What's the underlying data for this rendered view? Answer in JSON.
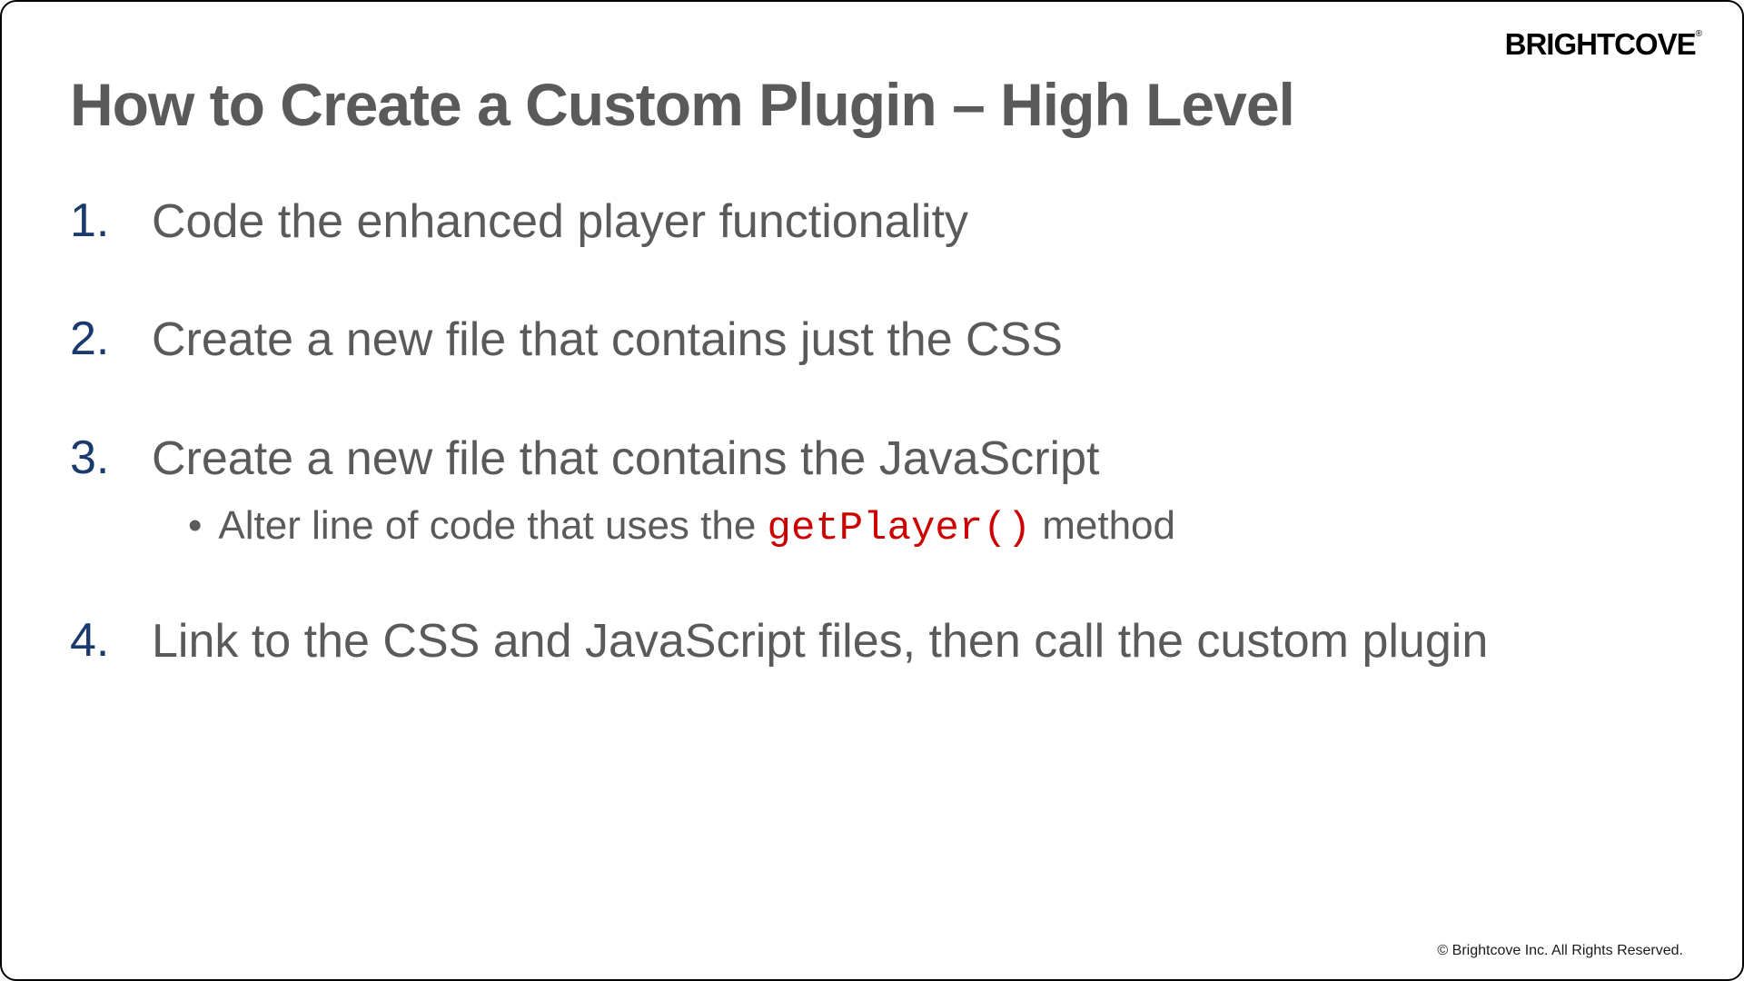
{
  "logo": {
    "text": "BRIGHTCOVE",
    "reg": "®"
  },
  "title": "How to Create a Custom Plugin – High Level",
  "items": [
    {
      "number": "1.",
      "text": "Code the enhanced player functionality"
    },
    {
      "number": "2.",
      "text": "Create a new file that contains just the CSS"
    },
    {
      "number": "3.",
      "text": "Create a new file that contains the JavaScript",
      "sub": {
        "prefix": "Alter line of code that uses the ",
        "code": "getPlayer()",
        "suffix": " method"
      }
    },
    {
      "number": "4.",
      "text": "Link to the CSS and JavaScript files, then call the custom plugin"
    }
  ],
  "copyright": "© Brightcove Inc. All Rights Reserved."
}
